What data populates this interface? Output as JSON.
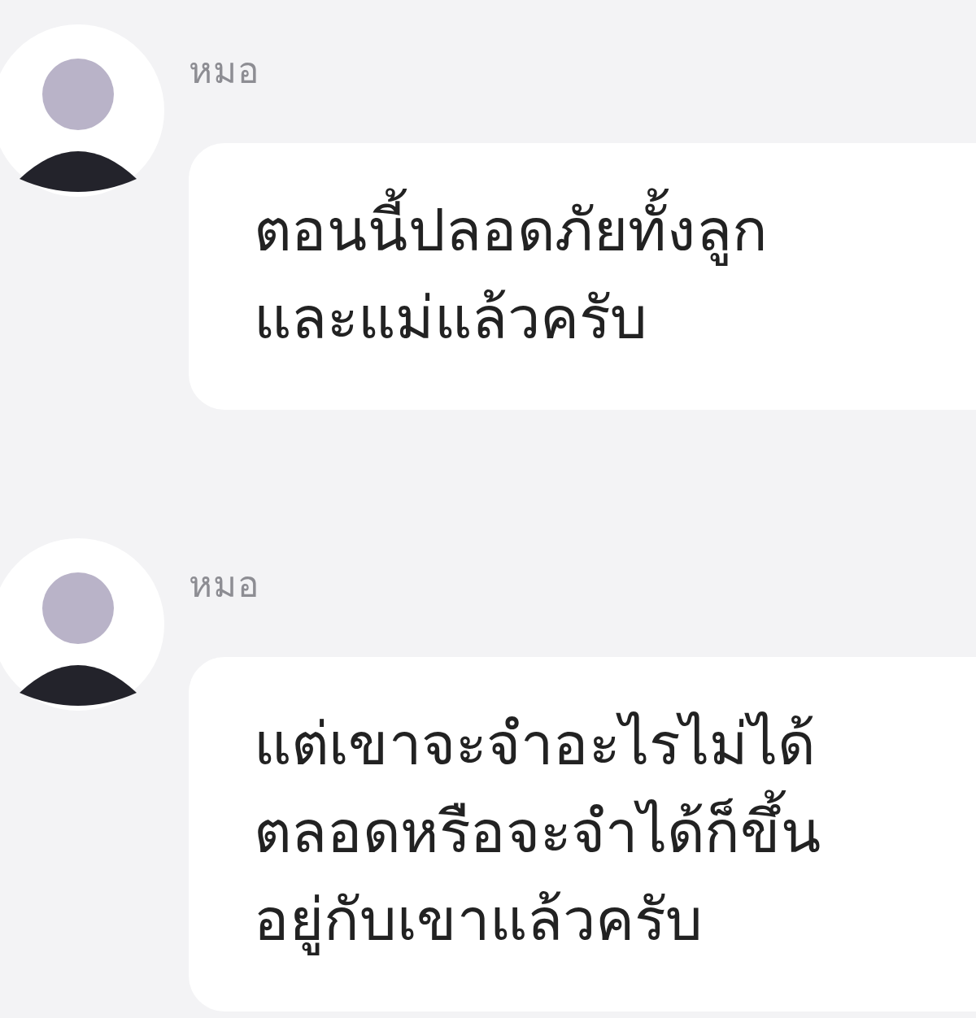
{
  "messages": [
    {
      "sender": "หมอ",
      "text": "ตอนนี้ปลอดภัยทั้งลูก\nและแม่แล้วครับ"
    },
    {
      "sender": "หมอ",
      "text": "แต่เขาจะจำอะไรไม่ได้\nตลอดหรือจะจำได้ก็ขึ้น\nอยู่กับเขาแล้วครับ"
    }
  ]
}
